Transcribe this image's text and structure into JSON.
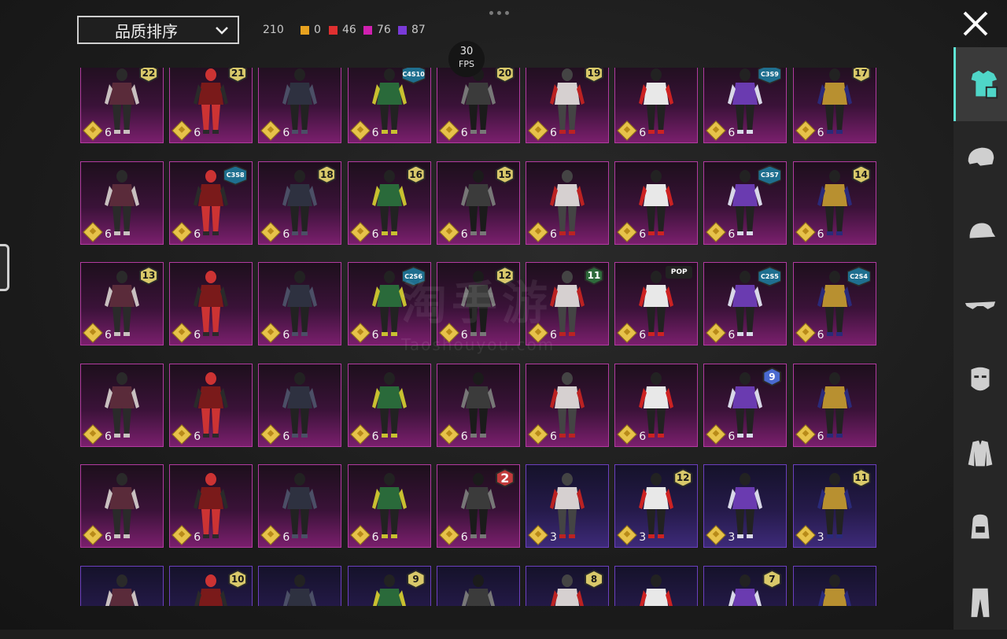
{
  "header": {
    "sort_label": "品质排序",
    "total": "210",
    "stats": [
      {
        "color": "#e8a21f",
        "value": "0"
      },
      {
        "color": "#e03030",
        "value": "46"
      },
      {
        "color": "#d020b0",
        "value": "76"
      },
      {
        "color": "#7a3ad8",
        "value": "87"
      }
    ],
    "fps_value": "30",
    "fps_unit": "FPS"
  },
  "watermark": {
    "main": "淘手游",
    "sub": "Taoshouyou.com"
  },
  "rows": [
    [
      {
        "rarity": "pink",
        "badge": "22",
        "count": "6"
      },
      {
        "rarity": "pink",
        "badge": "21",
        "count": "6"
      },
      {
        "rarity": "pink",
        "badge": "",
        "count": "6"
      },
      {
        "rarity": "pink",
        "badge": "C4S10",
        "count": "6"
      },
      {
        "rarity": "pink",
        "badge": "20",
        "count": "6"
      },
      {
        "rarity": "pink",
        "badge": "19",
        "count": "6"
      },
      {
        "rarity": "pink",
        "badge": "",
        "count": "6"
      },
      {
        "rarity": "pink",
        "badge": "C3S9",
        "count": "6"
      },
      {
        "rarity": "pink",
        "badge": "17",
        "count": "6"
      }
    ],
    [
      {
        "rarity": "pink",
        "badge": "",
        "count": "6"
      },
      {
        "rarity": "pink",
        "badge": "C3S8",
        "count": "6"
      },
      {
        "rarity": "pink",
        "badge": "18",
        "count": "6"
      },
      {
        "rarity": "pink",
        "badge": "16",
        "count": "6"
      },
      {
        "rarity": "pink",
        "badge": "15",
        "count": "6"
      },
      {
        "rarity": "pink",
        "badge": "",
        "count": "6"
      },
      {
        "rarity": "pink",
        "badge": "",
        "count": "6"
      },
      {
        "rarity": "pink",
        "badge": "C3S7",
        "count": "6"
      },
      {
        "rarity": "pink",
        "badge": "14",
        "count": "6"
      }
    ],
    [
      {
        "rarity": "pink",
        "badge": "13",
        "count": "6"
      },
      {
        "rarity": "pink",
        "badge": "",
        "count": "6"
      },
      {
        "rarity": "pink",
        "badge": "",
        "count": "6"
      },
      {
        "rarity": "pink",
        "badge": "C2S6",
        "count": "6"
      },
      {
        "rarity": "pink",
        "badge": "12",
        "count": "6"
      },
      {
        "rarity": "pink",
        "badge": "11",
        "count": "6"
      },
      {
        "rarity": "pink",
        "badge": "POP",
        "count": "6"
      },
      {
        "rarity": "pink",
        "badge": "C2S5",
        "count": "6"
      },
      {
        "rarity": "pink",
        "badge": "C2S4",
        "count": "6"
      }
    ],
    [
      {
        "rarity": "pink",
        "badge": "",
        "count": "6"
      },
      {
        "rarity": "pink",
        "badge": "",
        "count": "6"
      },
      {
        "rarity": "pink",
        "badge": "",
        "count": "6"
      },
      {
        "rarity": "pink",
        "badge": "",
        "count": "6"
      },
      {
        "rarity": "pink",
        "badge": "",
        "count": "6"
      },
      {
        "rarity": "pink",
        "badge": "",
        "count": "6"
      },
      {
        "rarity": "pink",
        "badge": "",
        "count": "6"
      },
      {
        "rarity": "pink",
        "badge": "9",
        "count": "6"
      },
      {
        "rarity": "pink",
        "badge": "",
        "count": "6"
      }
    ],
    [
      {
        "rarity": "pink",
        "badge": "",
        "count": "6"
      },
      {
        "rarity": "pink",
        "badge": "",
        "count": "6"
      },
      {
        "rarity": "pink",
        "badge": "",
        "count": "6"
      },
      {
        "rarity": "pink",
        "badge": "",
        "count": "6"
      },
      {
        "rarity": "pink",
        "badge": "2",
        "count": "6"
      },
      {
        "rarity": "purple",
        "badge": "",
        "count": "3"
      },
      {
        "rarity": "purple",
        "badge": "12",
        "count": "3"
      },
      {
        "rarity": "purple",
        "badge": "",
        "count": "3"
      },
      {
        "rarity": "purple",
        "badge": "11",
        "count": "3"
      }
    ],
    [
      {
        "rarity": "purple",
        "badge": "",
        "count": ""
      },
      {
        "rarity": "purple",
        "badge": "10",
        "count": ""
      },
      {
        "rarity": "purple",
        "badge": "",
        "count": ""
      },
      {
        "rarity": "purple",
        "badge": "9",
        "count": ""
      },
      {
        "rarity": "purple",
        "badge": "",
        "count": ""
      },
      {
        "rarity": "purple",
        "badge": "8",
        "count": ""
      },
      {
        "rarity": "purple",
        "badge": "",
        "count": ""
      },
      {
        "rarity": "purple",
        "badge": "7",
        "count": ""
      },
      {
        "rarity": "purple",
        "badge": "",
        "count": ""
      }
    ]
  ],
  "sidebar_tabs": [
    {
      "icon": "outfit-icon",
      "active": true
    },
    {
      "icon": "helmet-icon",
      "active": false
    },
    {
      "icon": "cap-icon",
      "active": false
    },
    {
      "icon": "glasses-icon",
      "active": false
    },
    {
      "icon": "mask-icon",
      "active": false
    },
    {
      "icon": "jacket-icon",
      "active": false
    },
    {
      "icon": "backpack-icon",
      "active": false
    },
    {
      "icon": "pants-icon",
      "active": false
    }
  ],
  "colors": {
    "accent": "#5fe6d6",
    "pink_rarity": "#b23aa0",
    "purple_rarity": "#6c3fbf"
  }
}
